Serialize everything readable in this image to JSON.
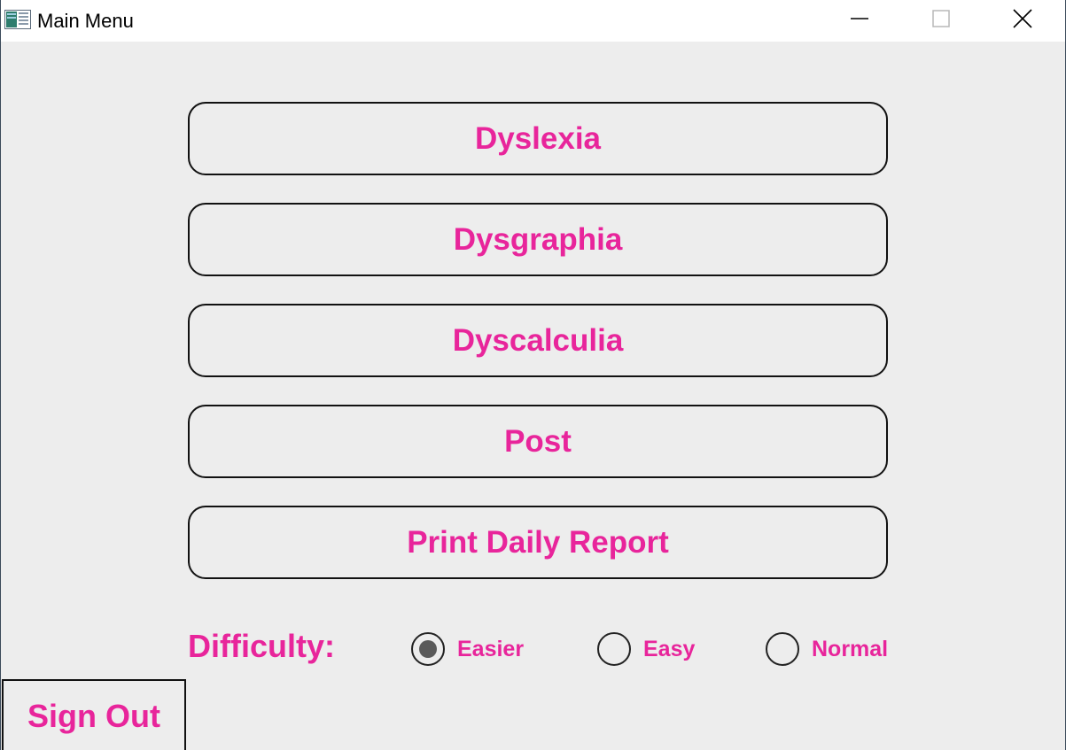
{
  "window": {
    "title": "Main Menu",
    "app_icon": "app-window-icon",
    "controls": {
      "minimize_icon": "minimize-icon",
      "maximize_icon": "maximize-icon",
      "close_icon": "close-icon"
    }
  },
  "menu": {
    "buttons": [
      {
        "label": "Dyslexia"
      },
      {
        "label": "Dysgraphia"
      },
      {
        "label": "Dyscalculia"
      },
      {
        "label": "Post"
      },
      {
        "label": "Print Daily Report"
      }
    ]
  },
  "difficulty": {
    "label": "Difficulty:",
    "options": [
      {
        "label": "Easier",
        "selected": true
      },
      {
        "label": "Easy",
        "selected": false
      },
      {
        "label": "Normal",
        "selected": false
      }
    ]
  },
  "sign_out": {
    "label": "Sign Out"
  },
  "colors": {
    "accent_text": "#e8259b",
    "background": "#ededed"
  }
}
